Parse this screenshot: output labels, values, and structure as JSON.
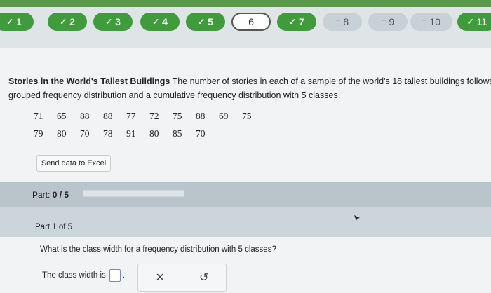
{
  "nav": {
    "questions": [
      {
        "label": "1",
        "state": "done",
        "mark": "✓"
      },
      {
        "label": "2",
        "state": "done",
        "mark": "✓"
      },
      {
        "label": "3",
        "state": "done",
        "mark": "✓"
      },
      {
        "label": "4",
        "state": "done",
        "mark": "✓"
      },
      {
        "label": "5",
        "state": "done",
        "mark": "✓"
      },
      {
        "label": "6",
        "state": "current",
        "mark": ""
      },
      {
        "label": "7",
        "state": "done",
        "mark": "✓"
      },
      {
        "label": "8",
        "state": "partial",
        "mark": "="
      },
      {
        "label": "9",
        "state": "partial",
        "mark": "="
      },
      {
        "label": "10",
        "state": "partial",
        "mark": "="
      },
      {
        "label": "11",
        "state": "done",
        "mark": "✓"
      }
    ]
  },
  "problem": {
    "title": "Stories in the World's Tallest Buildings",
    "text_line1": " The number of stories in each of a sample of the world's 18 tallest buildings follows. Co",
    "text_line2": "grouped frequency distribution and a cumulative frequency distribution with 5 classes.",
    "data_row1": [
      "71",
      "65",
      "88",
      "88",
      "77",
      "72",
      "75",
      "88",
      "69",
      "75"
    ],
    "data_row2": [
      "79",
      "80",
      "70",
      "78",
      "91",
      "80",
      "85",
      "70"
    ],
    "send_button": "Send data to Excel"
  },
  "part_progress": {
    "label": "Part:",
    "value": "0 / 5",
    "progress": 0
  },
  "part1": {
    "label": "Part 1 of 5",
    "question": "What is the class width for a frequency distribution with 5 classes?",
    "answer_prefix": "The class width is",
    "answer_value": "",
    "answer_suffix": "."
  },
  "tools": {
    "clear": "✕",
    "undo": "↺"
  },
  "colors": {
    "done": "#3f9c3b",
    "accent_green": "#5a9a4a"
  }
}
